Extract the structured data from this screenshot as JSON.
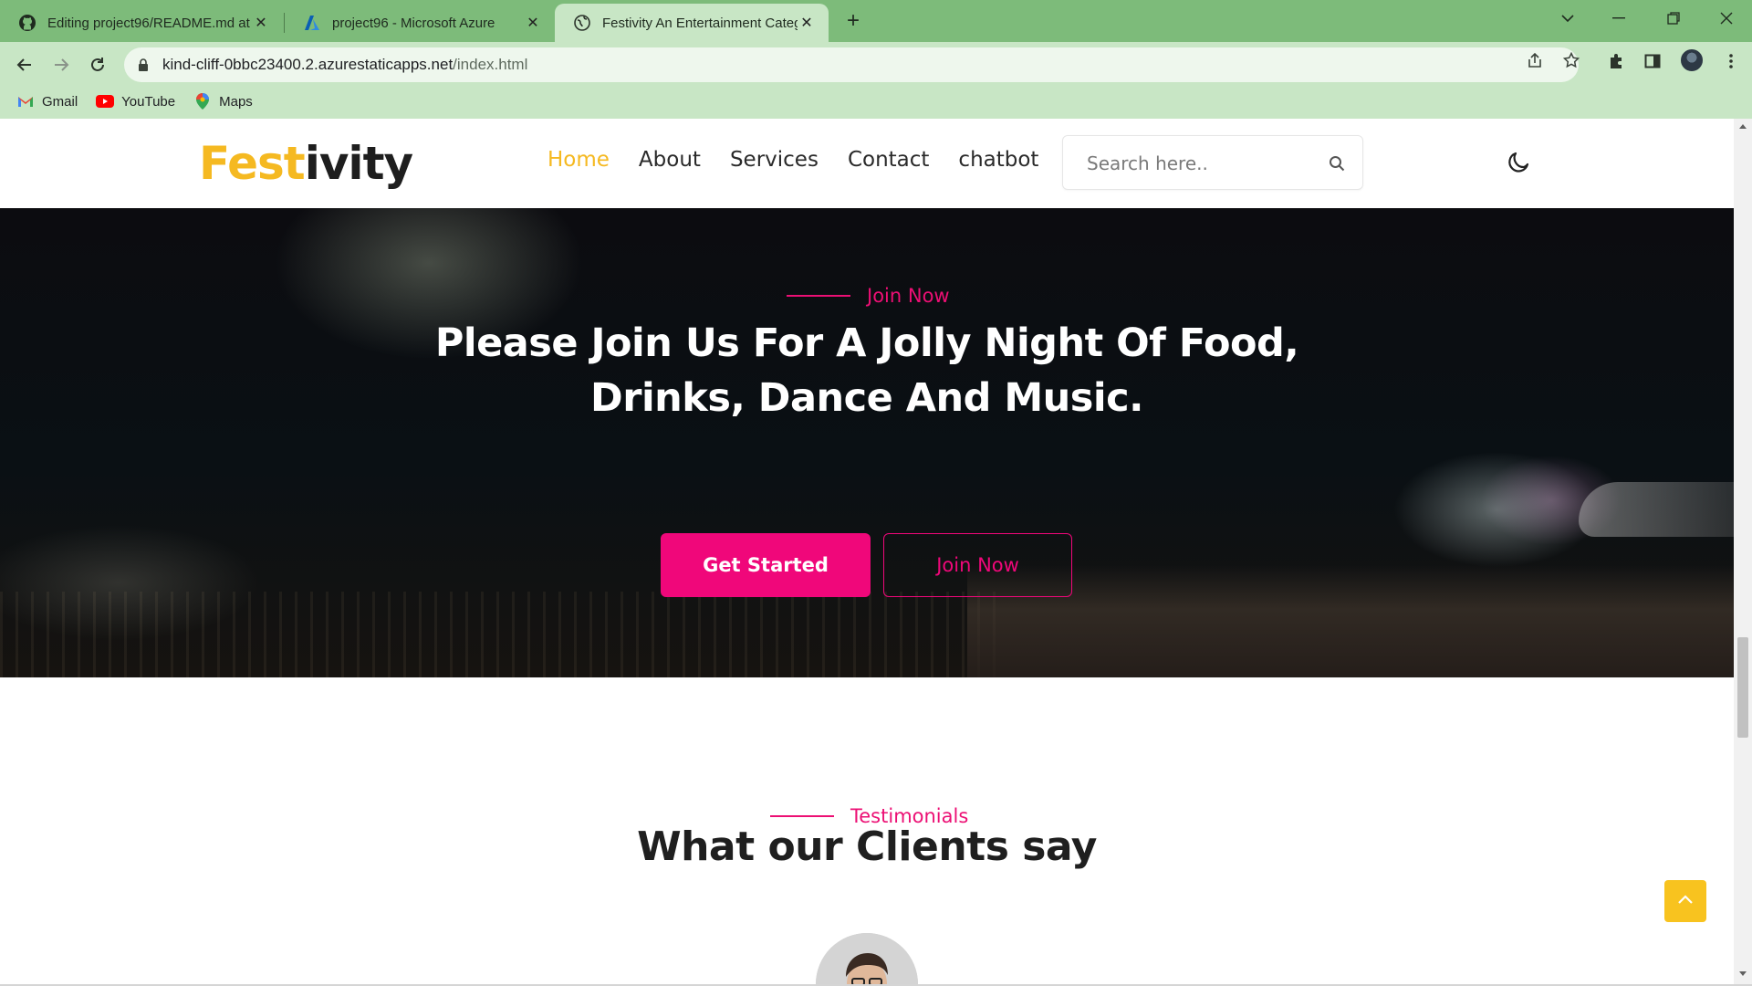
{
  "browser": {
    "tabs": [
      {
        "title": "Editing project96/README.md at",
        "icon": "github-icon"
      },
      {
        "title": "project96 - Microsoft Azure",
        "icon": "azure-icon"
      },
      {
        "title": "Festivity An Entertainment Categ",
        "icon": "globe-icon",
        "active": true
      }
    ],
    "url_host": "kind-cliff-0bbc23400.2.azurestaticapps.net",
    "url_path": "/index.html",
    "bookmarks": [
      {
        "label": "Gmail",
        "icon": "gmail-icon"
      },
      {
        "label": "YouTube",
        "icon": "youtube-icon"
      },
      {
        "label": "Maps",
        "icon": "maps-icon"
      }
    ],
    "theme_color": "#7dbb7a"
  },
  "site": {
    "logo_part1": "Fest",
    "logo_part2": "ivity",
    "nav": [
      "Home",
      "About",
      "Services",
      "Contact",
      "chatbot"
    ],
    "active_nav": "Home",
    "search_placeholder": "Search here..",
    "accent_yellow": "#f5b921",
    "accent_pink": "#f0077a"
  },
  "hero": {
    "eyebrow": "Join Now",
    "title_line1": "Please Join Us For A Jolly Night Of Food,",
    "title_line2": "Drinks, Dance And Music.",
    "primary_button": "Get Started",
    "secondary_button": "Join Now"
  },
  "testimonials": {
    "eyebrow": "Testimonials",
    "title": "What our Clients say"
  }
}
